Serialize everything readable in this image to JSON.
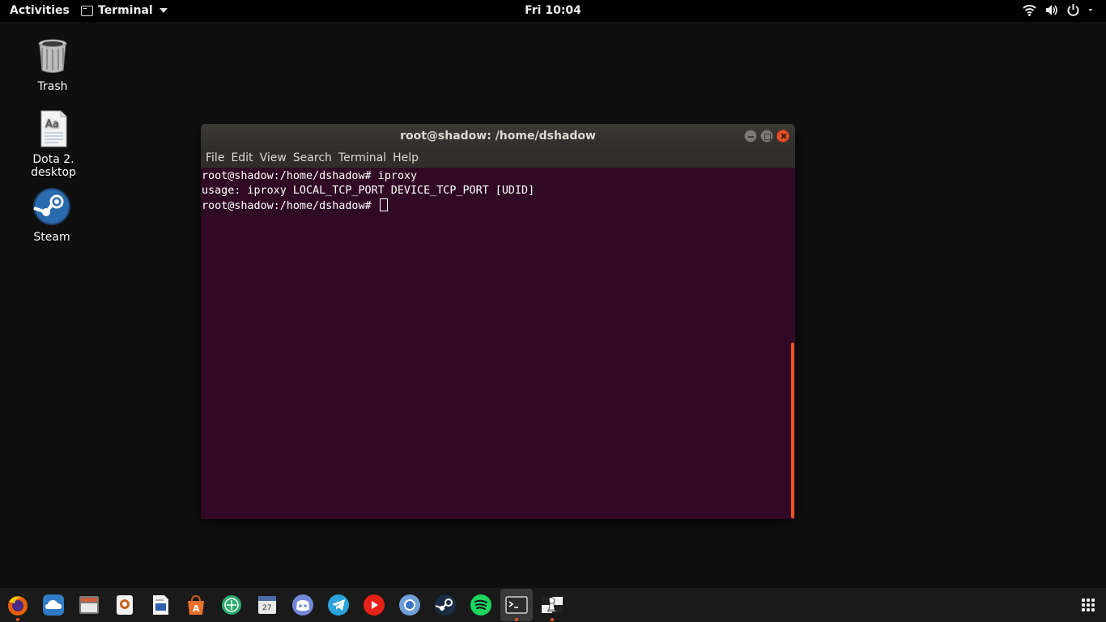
{
  "topbar": {
    "activities": "Activities",
    "app_name": "Terminal",
    "clock": "Fri 10:04",
    "tray_icons": [
      "wifi-icon",
      "volume-icon",
      "power-icon",
      "chevron-down-icon"
    ]
  },
  "desktop": {
    "icons": [
      {
        "label": "Trash",
        "icon": "trash-icon"
      },
      {
        "label_line1": "Dota 2.",
        "label_line2": "desktop",
        "icon": "desktop-file-icon"
      },
      {
        "label": "Steam",
        "icon": "steam-icon"
      }
    ]
  },
  "terminal": {
    "title": "root@shadow: /home/dshadow",
    "menu": [
      "File",
      "Edit",
      "View",
      "Search",
      "Terminal",
      "Help"
    ],
    "lines": [
      "root@shadow:/home/dshadow# iproxy",
      "usage: iproxy LOCAL_TCP_PORT DEVICE_TCP_PORT [UDID]",
      "root@shadow:/home/dshadow# "
    ],
    "background": "#300a24",
    "scrollbar_color": "#e95420"
  },
  "dock": {
    "items": [
      "firefox-icon",
      "cloud-icon",
      "files-icon",
      "vpn-icon",
      "text-editor-icon",
      "software-center-icon",
      "trello-icon",
      "calendar-icon",
      "discord-icon",
      "telegram-icon",
      "youtube-icon",
      "chromium-icon",
      "steam-icon",
      "spotify-icon",
      "terminal-icon",
      "chess-icon"
    ],
    "show_apps": "apps-grid-icon"
  }
}
